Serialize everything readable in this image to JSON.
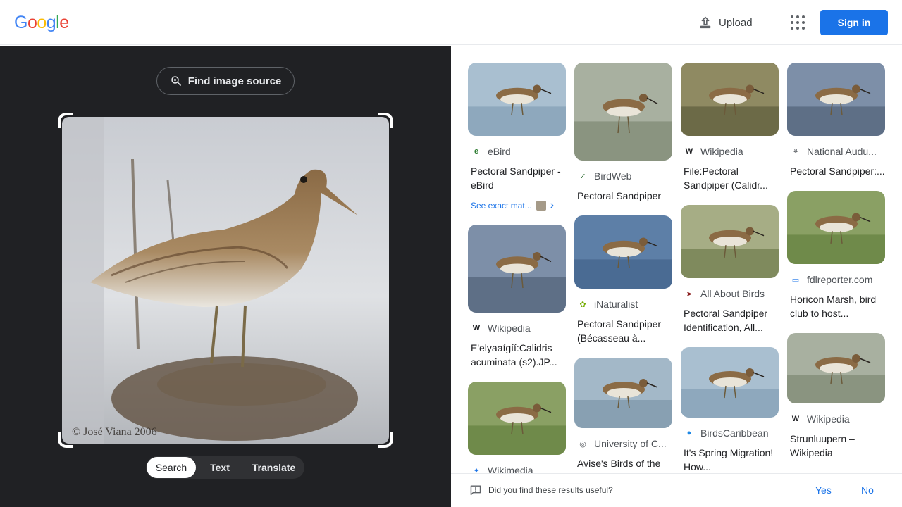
{
  "header": {
    "logo_letters": [
      "G",
      "o",
      "o",
      "g",
      "l",
      "e"
    ],
    "logo_colors": [
      "#4285f4",
      "#ea4335",
      "#fbbc05",
      "#4285f4",
      "#34a853",
      "#ea4335"
    ],
    "upload_label": "Upload",
    "upload_icon": "upload-icon",
    "apps_icon": "apps-grid-icon",
    "signin_label": "Sign in"
  },
  "left": {
    "find_source_label": "Find image source",
    "find_source_icon": "lens-search-icon",
    "watermark": "© José Viana 2006",
    "tabs": [
      "Search",
      "Text",
      "Translate"
    ],
    "active_tab": "Search"
  },
  "results": {
    "columns": [
      [
        {
          "source": "eBird",
          "icon_char": "e",
          "icon_color": "#2e7d32",
          "title": "Pectoral Sandpiper - eBird",
          "exact_label": "See exact mat...",
          "h": 104
        },
        {
          "source": "Wikipedia",
          "icon_char": "W",
          "icon_color": "#202124",
          "title": "E'elyaaígíí:Calidris acuminata (s2).JP...",
          "h": 125
        },
        {
          "source": "Wikimedia",
          "icon_char": "✦",
          "icon_color": "#1a73e8",
          "title": "",
          "h": 104
        }
      ],
      [
        {
          "source": "BirdWeb",
          "icon_char": "✓",
          "icon_color": "#1b5e20",
          "title": "Pectoral Sandpiper",
          "h": 139
        },
        {
          "source": "iNaturalist",
          "icon_char": "✿",
          "icon_color": "#74ac00",
          "title": "Pectoral Sandpiper (Bécasseau à...",
          "h": 104
        },
        {
          "source": "University of C...",
          "icon_char": "◎",
          "icon_color": "#5f6368",
          "title": "Avise's Birds of the",
          "h": 100
        }
      ],
      [
        {
          "source": "Wikipedia",
          "icon_char": "W",
          "icon_color": "#202124",
          "title": "File:Pectoral Sandpiper (Calidr...",
          "h": 104
        },
        {
          "source": "All About Birds",
          "icon_char": "➤",
          "icon_color": "#8b1e1e",
          "title": "Pectoral Sandpiper Identification, All...",
          "h": 104
        },
        {
          "source": "BirdsCaribbean",
          "icon_char": "●",
          "icon_color": "#1e88e5",
          "title": "It's Spring Migration! How...",
          "h": 100
        }
      ],
      [
        {
          "source": "National Audu...",
          "icon_char": "⚘",
          "icon_color": "#5f6368",
          "title": "Pectoral Sandpiper:...",
          "h": 104
        },
        {
          "source": "fdlreporter.com",
          "icon_char": "▭",
          "icon_color": "#1a73e8",
          "title": "Horicon Marsh, bird club to host...",
          "h": 104
        },
        {
          "source": "Wikipedia",
          "icon_char": "W",
          "icon_color": "#202124",
          "title": "Strunluupern – Wikipedia",
          "h": 100
        }
      ]
    ]
  },
  "feedback": {
    "question": "Did you find these results useful?",
    "yes": "Yes",
    "no": "No",
    "icon": "feedback-icon"
  }
}
